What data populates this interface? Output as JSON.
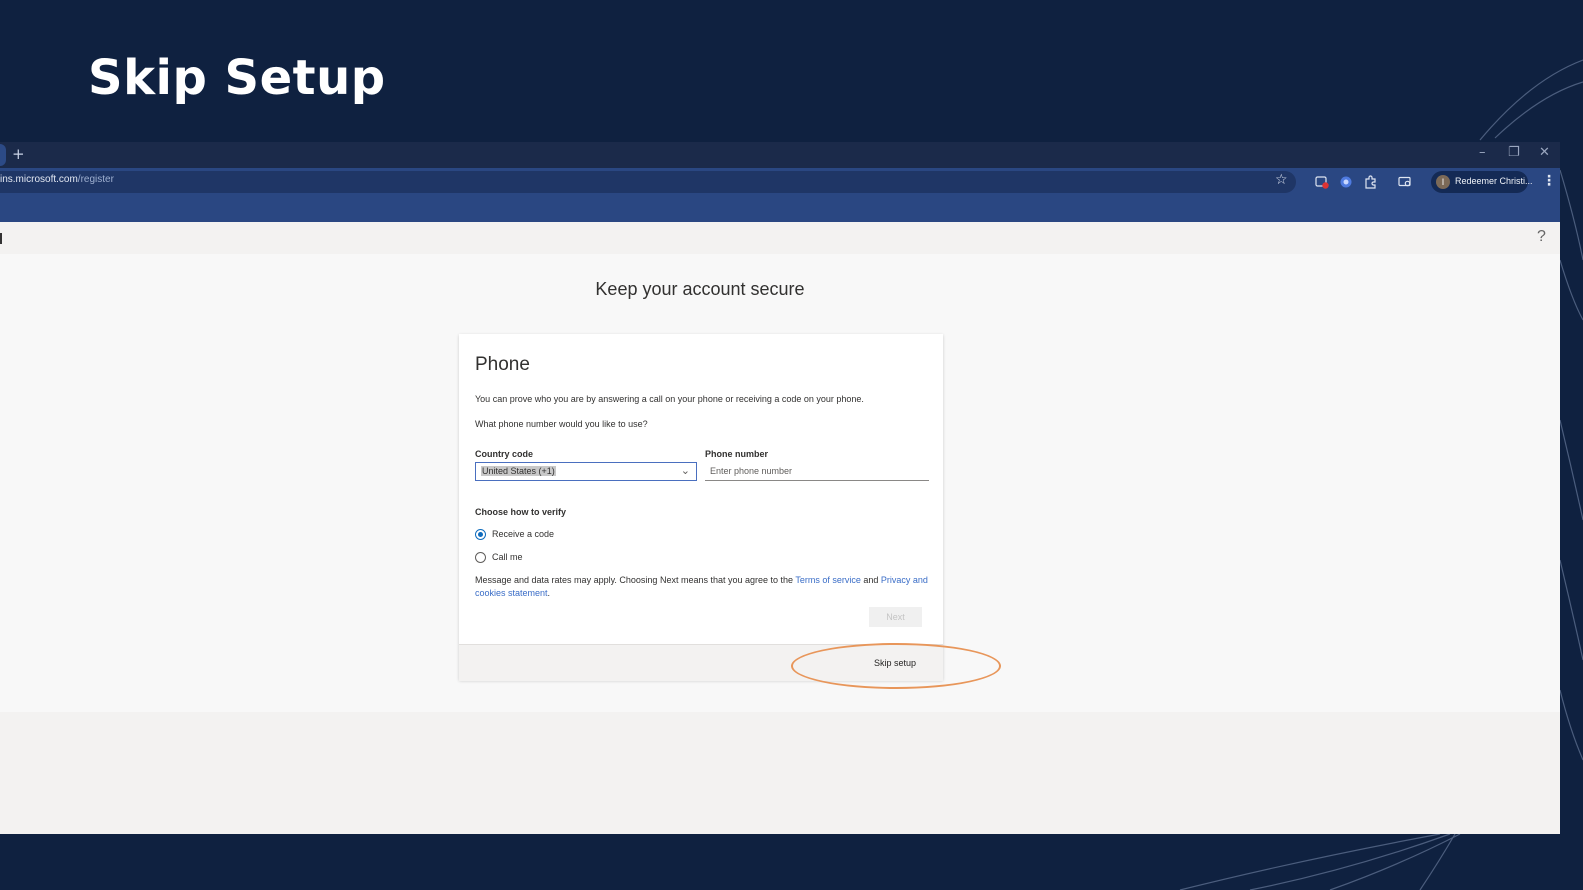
{
  "slide": {
    "title": "Skip Setup"
  },
  "browser": {
    "new_tab_symbol": "+",
    "window_controls": {
      "minimize": "–",
      "restore": "❐",
      "close": "✕"
    },
    "url_host": "ins.microsoft.com",
    "url_path": "/register",
    "bookmark_star": "☆",
    "profile_initial": "I",
    "profile_name": "Redeemer Christi...",
    "menu_symbol": "⋮"
  },
  "page": {
    "help_symbol": "?",
    "heading": "Keep your account secure",
    "card": {
      "title": "Phone",
      "description": "You can prove who you are by answering a call on your phone or receiving a code on your phone.",
      "question": "What phone number would you like to use?",
      "country_code_label": "Country code",
      "country_code_value": "United States (+1)",
      "phone_number_label": "Phone number",
      "phone_placeholder": "Enter phone number",
      "verify_label": "Choose how to verify",
      "options": [
        {
          "label": "Receive a code",
          "selected": true
        },
        {
          "label": "Call me",
          "selected": false
        }
      ],
      "terms_prefix": "Message and data rates may apply. Choosing Next means that you agree to the ",
      "terms_link": "Terms of service",
      "terms_and": " and ",
      "privacy_link": "Privacy and cookies statement",
      "terms_suffix": ".",
      "next_label": "Next",
      "skip_label": "Skip setup"
    }
  },
  "colors": {
    "slide_background": "#0f2140",
    "browser_toolbar": "#2a4782",
    "link": "#3a6dc7",
    "highlight": "#e8965a"
  }
}
